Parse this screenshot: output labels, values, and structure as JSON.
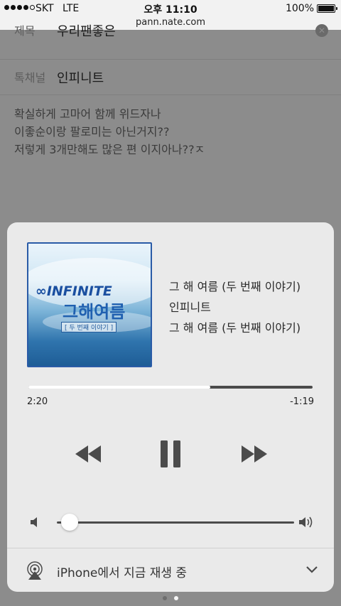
{
  "status_bar": {
    "carrier": "SKT",
    "network": "LTE",
    "time": "오후 11:10",
    "battery": "100%",
    "signal_bars_filled": 4,
    "signal_bars_total": 5
  },
  "browser": {
    "url": "pann.nate.com"
  },
  "background_page": {
    "title_label": "제목",
    "title_value": "우리팬좋은",
    "channel_label": "톡채널",
    "channel_value": "인피니트",
    "comment_lines": [
      "확실하게 고마어 함께 위드자나",
      "이좋순이랑 팔로미는 아닌거지??",
      "저렇게 3개만해도 많은 편 이지아나??ㅈ"
    ]
  },
  "now_playing": {
    "artwork_icon": "album-artwork",
    "artwork_text_logo": "∞INFINITE",
    "artwork_text_title": "그해여름",
    "artwork_text_sub": "[ 두 번째 이야기 ]",
    "song_title": "그 해 여름 (두 번째 이야기)",
    "artist": "인피니트",
    "album": "그 해 여름 (두 번째 이야기)",
    "elapsed": "2:20",
    "remaining": "-1:19",
    "progress_fraction": 0.64,
    "volume_fraction": 0.02,
    "airplay_label": "iPhone에서 지금 재생 중"
  },
  "page_dots": {
    "count": 2,
    "active_index": 1
  },
  "colors": {
    "card_bg": "#eaeaea",
    "dim_bg": "#8c8c8c",
    "control_dark": "#4b4b4b"
  }
}
